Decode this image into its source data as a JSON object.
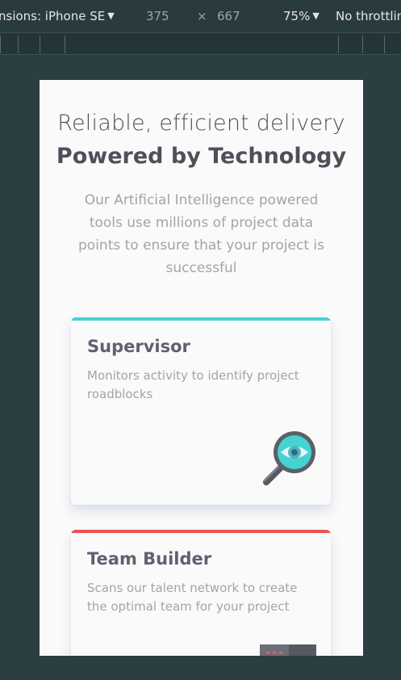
{
  "devtools": {
    "dimensions_label": "nsions: iPhone SE",
    "width": "375",
    "times": "×",
    "height": "667",
    "zoom": "75%",
    "throttling": "No throttlin"
  },
  "hero": {
    "tagline": "Reliable, efficient delivery",
    "headline": "Powered by Technology",
    "intro": "Our Artificial Intelligence powered tools use millions of project data points to ensure that your project is successful"
  },
  "cards": [
    {
      "title": "Supervisor",
      "description": "Monitors activity to identify project roadblocks",
      "accent": "#44d3d2",
      "icon": "magnifier-eye-icon"
    },
    {
      "title": "Team Builder",
      "description": "Scans our talent network to create the optimal team for your project",
      "accent": "#ea5454",
      "icon": "team-builder-icon"
    }
  ]
}
